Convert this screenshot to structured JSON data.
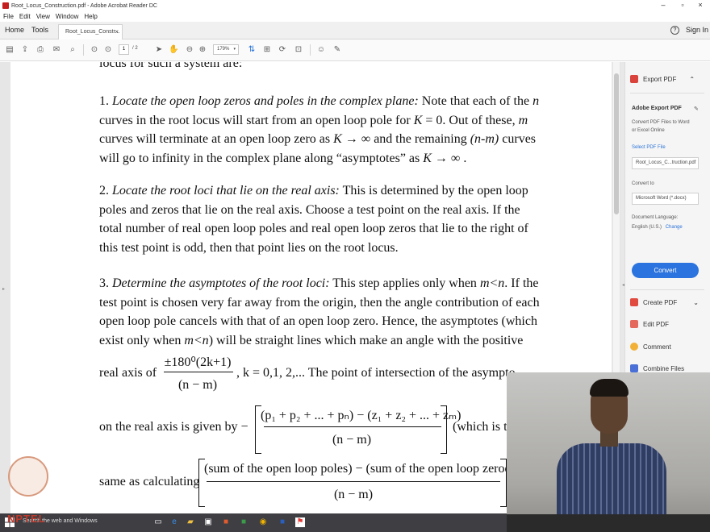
{
  "window": {
    "title": "Root_Locus_Construction.pdf - Adobe Acrobat Reader DC",
    "controls": [
      "–",
      "▫",
      "×"
    ]
  },
  "menu": [
    "File",
    "Edit",
    "View",
    "Window",
    "Help"
  ],
  "tabs": {
    "home": "Home",
    "tools": "Tools",
    "doc": "Root_Locus_Constr...",
    "close": "×",
    "help": "?",
    "signin": "Sign In"
  },
  "toolbar": {
    "page_current": "1",
    "page_total": "/ 2",
    "zoom": "179%",
    "icons": [
      "create-icon",
      "upload-icon",
      "print-icon",
      "email-icon",
      "search-icon",
      "prev-page-icon",
      "next-page-icon",
      "select-cursor-icon",
      "hand-icon",
      "zoom-out-icon",
      "zoom-in-icon",
      "fit-icon",
      "scroll-mode-icon",
      "rotate-icon",
      "presentation-icon",
      "comment-icon",
      "pen-icon"
    ]
  },
  "page": {
    "line0": "locus for such a system are:",
    "p1": [
      {
        "parts": [
          {
            "t": "1. "
          },
          {
            "t": "Locate the open loop zeros and poles in the complex plane:",
            "i": true
          },
          {
            "t": " Note that each of the "
          },
          {
            "t": "n",
            "i": true
          }
        ]
      },
      {
        "parts": [
          {
            "t": "curves in the root locus will start from an open loop pole for "
          },
          {
            "t": "K",
            "i": true
          },
          {
            "t": " = 0. Out of these, "
          },
          {
            "t": "m",
            "i": true
          }
        ]
      },
      {
        "parts": [
          {
            "t": "curves will terminate at an open loop zero as  "
          },
          {
            "t": "K",
            "i": true
          },
          {
            "t": " → ∞ and the remaining "
          },
          {
            "t": "(n-m)",
            "i": true
          },
          {
            "t": " curves"
          }
        ]
      },
      {
        "parts": [
          {
            "t": "will go to infinity in the complex plane along “asymptotes” as  "
          },
          {
            "t": "K",
            "i": true
          },
          {
            "t": " → ∞ ."
          }
        ]
      }
    ],
    "p2": [
      {
        "parts": [
          {
            "t": "2. "
          },
          {
            "t": "Locate the root loci that lie on the real axis:",
            "i": true
          },
          {
            "t": " This is determined by the open loop"
          }
        ]
      },
      {
        "parts": [
          {
            "t": "poles and zeros that lie on the real axis. Choose a test point on the real axis. If the"
          }
        ]
      },
      {
        "parts": [
          {
            "t": "total number of real open loop poles and real open loop zeros that lie to the right of"
          }
        ]
      },
      {
        "parts": [
          {
            "t": "this test point is odd, then that point lies on the root locus."
          }
        ]
      }
    ],
    "p3": [
      {
        "parts": [
          {
            "t": "3. "
          },
          {
            "t": "Determine the asymptotes of the root loci:",
            "i": true
          },
          {
            "t": " This step applies only when "
          },
          {
            "t": "m<n",
            "i": true
          },
          {
            "t": ". If the"
          }
        ]
      },
      {
        "parts": [
          {
            "t": "test point is chosen very far away from the origin, then the angle contribution of each"
          }
        ]
      },
      {
        "parts": [
          {
            "t": "open loop pole cancels with that of an open loop zero. Hence, the asymptotes (which"
          }
        ]
      },
      {
        "parts": [
          {
            "t": "exist only when "
          },
          {
            "t": "m<n",
            "i": true
          },
          {
            "t": ") will be straight lines which make an angle with the positive"
          }
        ]
      }
    ],
    "eq1": {
      "prefix": "real axis of",
      "num": "±180⁰(2k+1)",
      "den": "(n − m)",
      "suffix": ", k = 0,1, 2,...  The point of intersection of the asympto"
    },
    "eq2": {
      "prefix": "on the real axis is given by  −",
      "num": "(p₁ + p₂ + ... + pₙ) − (z₁ + z₂ + ... + zₘ)",
      "den": "(n − m)",
      "suffix": "(which is t"
    },
    "eq3": {
      "prefix": "same as calculating",
      "num": "(sum of the open loop poles) − (sum of the open loop zeroes)",
      "den": "(n − m)"
    }
  },
  "right_panel": {
    "export_pdf": "Export PDF",
    "adobe_export": "Adobe Export PDF",
    "desc1": "Convert PDF Files to Word",
    "desc2": "or Excel Online",
    "select_file": "Select PDF File",
    "file_name": "Root_Locus_C...truction.pdf",
    "convert_to": "Convert to",
    "format": "Microsoft Word (*.docx)",
    "doc_lang": "Document Language:",
    "lang": "English (U.S.)",
    "change": "Change",
    "convert_btn": "Convert",
    "tools": [
      "Create PDF",
      "Edit PDF",
      "Comment",
      "Combine Files"
    ]
  },
  "taskbar": {
    "search": "Search the web and Windows"
  },
  "logo": {
    "text": "NPTEL"
  },
  "colors": {
    "accent": "#2b73de",
    "acrobat_red": "#c41e1e"
  }
}
